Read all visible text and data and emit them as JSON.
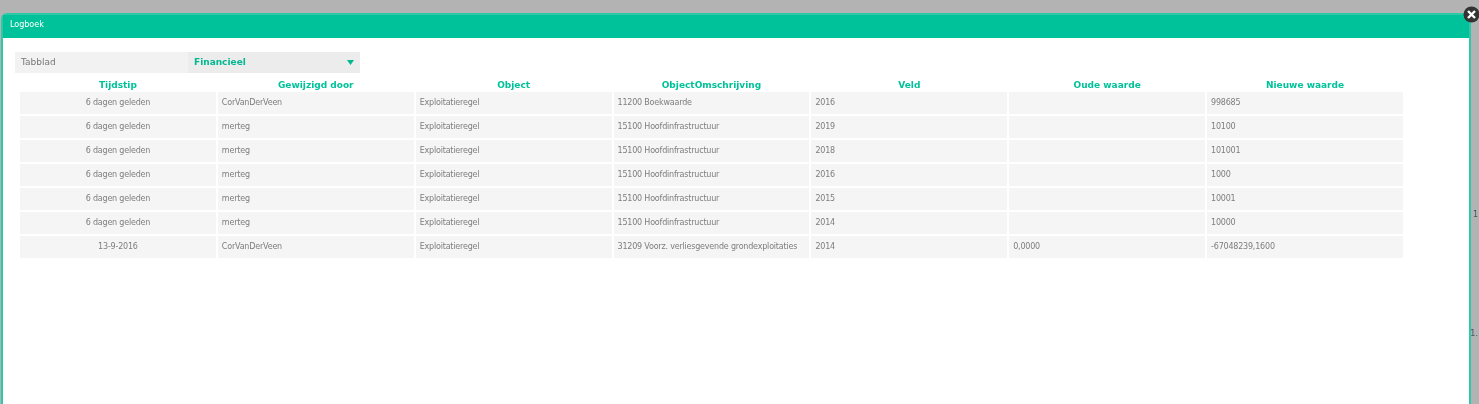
{
  "window": {
    "title": "Logboek"
  },
  "filter": {
    "label": "Tabblad",
    "value": "Financieel"
  },
  "table": {
    "columns": [
      "Tijdstip",
      "Gewijzigd door",
      "Object",
      "ObjectOmschrijving",
      "Veld",
      "Oude waarde",
      "Nieuwe waarde"
    ],
    "rows": [
      [
        "6 dagen geleden",
        "CorVanDerVeen",
        "Exploitatieregel",
        "11200 Boekwaarde",
        "2016",
        "",
        "998685"
      ],
      [
        "6 dagen geleden",
        "merteg",
        "Exploitatieregel",
        "15100 Hoofdinfrastructuur",
        "2019",
        "",
        "10100"
      ],
      [
        "6 dagen geleden",
        "merteg",
        "Exploitatieregel",
        "15100 Hoofdinfrastructuur",
        "2018",
        "",
        "101001"
      ],
      [
        "6 dagen geleden",
        "merteg",
        "Exploitatieregel",
        "15100 Hoofdinfrastructuur",
        "2016",
        "",
        "1000"
      ],
      [
        "6 dagen geleden",
        "merteg",
        "Exploitatieregel",
        "15100 Hoofdinfrastructuur",
        "2015",
        "",
        "10001"
      ],
      [
        "6 dagen geleden",
        "merteg",
        "Exploitatieregel",
        "15100 Hoofdinfrastructuur",
        "2014",
        "",
        "10000"
      ],
      [
        "13-9-2016",
        "CorVanDerVeen",
        "Exploitatieregel",
        "31209 Voorz. verliesgevende grondexploitaties",
        "2014",
        "0,0000",
        "-67048239,1600"
      ]
    ]
  },
  "backdrop_texts": [
    "1",
    "1."
  ]
}
